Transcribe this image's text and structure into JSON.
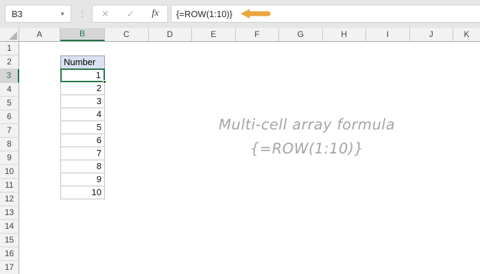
{
  "titlebar": {
    "name_box": "B3",
    "name_box_caret": "▼",
    "drag_dots": "⋮",
    "cancel_icon": "✕",
    "enter_icon": "✓",
    "fx_label": "fx",
    "formula": "{=ROW(1:10)}"
  },
  "colors": {
    "accent_green": "#217346",
    "arrow_orange": "#EAA63C",
    "input_cell_blue": "#d9e1f2",
    "watermark_gray": "#a5a5a8"
  },
  "grid": {
    "selected_cell": "B3",
    "col_headers": [
      "A",
      "B",
      "C",
      "D",
      "E",
      "F",
      "G",
      "H",
      "I",
      "J",
      "K"
    ],
    "row_headers": [
      "1",
      "2",
      "3",
      "4",
      "5",
      "6",
      "7",
      "8",
      "9",
      "10",
      "11",
      "12",
      "13",
      "14",
      "15",
      "16",
      "17"
    ],
    "header_cell": {
      "ref": "B2",
      "value": "Number"
    },
    "values": [
      "1",
      "2",
      "3",
      "4",
      "5",
      "6",
      "7",
      "8",
      "9",
      "10"
    ]
  },
  "watermark": {
    "line1": "Multi-cell array formula",
    "line2": "{=ROW(1:10)}"
  }
}
